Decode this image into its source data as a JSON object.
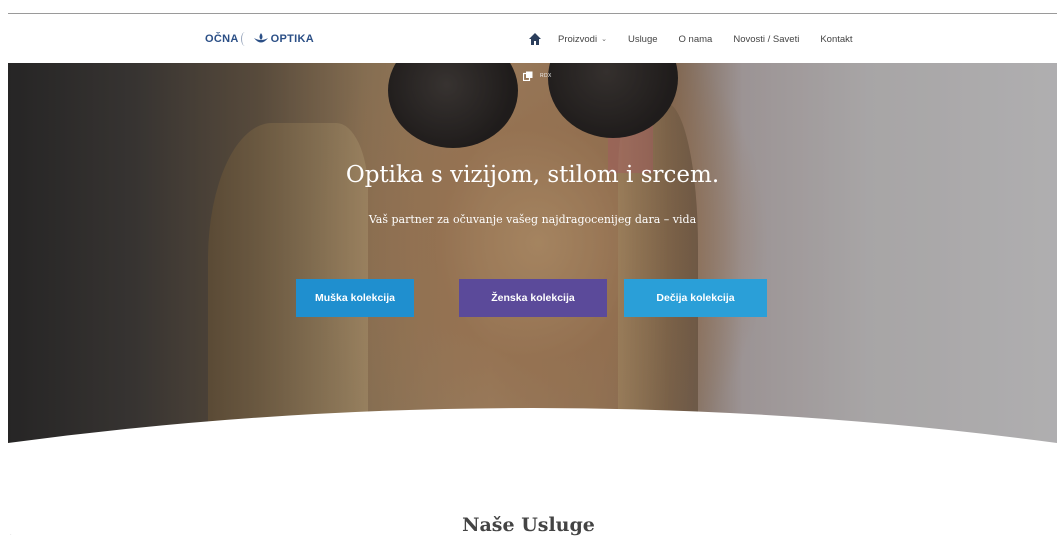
{
  "nav": {
    "logo_left": "OČNA",
    "logo_right": "OPTIKA",
    "home_icon": "home-icon",
    "items": [
      {
        "label": "Proizvodi",
        "has_dropdown": true
      },
      {
        "label": "Usluge"
      },
      {
        "label": "O nama"
      },
      {
        "label": "Novosti / Saveti"
      },
      {
        "label": "Kontakt"
      }
    ]
  },
  "hero": {
    "badge_icon": "copy-icon",
    "badge_text": "RDX",
    "title": "Optika s vizijom, stilom i srcem.",
    "subtitle": "Vaš partner za očuvanje vašeg najdragocenijeg dara – vida",
    "buttons": [
      {
        "label": "Muška kolekcija",
        "color": "#1f8fcf"
      },
      {
        "label": "Ženska kolekcija",
        "color": "#5b4a9a"
      },
      {
        "label": "Dečija kolekcija",
        "color": "#2a9fd8"
      }
    ]
  },
  "section": {
    "title": "Naše Usluge"
  },
  "colors": {
    "brand": "#2b4f86",
    "accent_blue": "#1f8fcf",
    "accent_purple": "#5b4a9a"
  }
}
